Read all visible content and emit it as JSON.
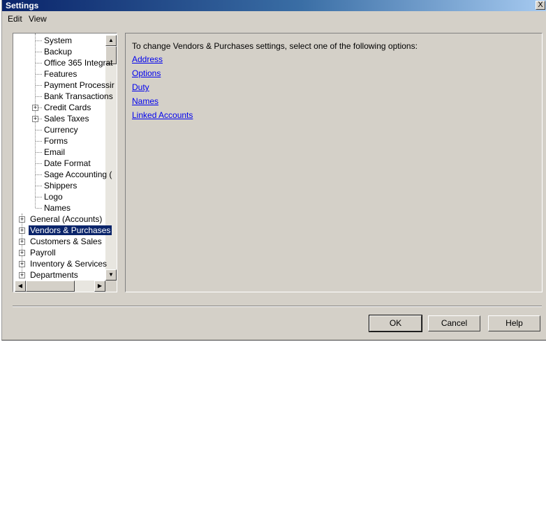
{
  "window": {
    "title": "Settings",
    "close_glyph": "X"
  },
  "menu": [
    "Edit",
    "View"
  ],
  "tree": {
    "children": [
      {
        "label": "System",
        "expandable": false
      },
      {
        "label": "Backup",
        "expandable": false
      },
      {
        "label": "Office 365 Integrat",
        "expandable": false
      },
      {
        "label": "Features",
        "expandable": false
      },
      {
        "label": "Payment Processir",
        "expandable": false
      },
      {
        "label": "Bank Transactions",
        "expandable": false
      },
      {
        "label": "Credit Cards",
        "expandable": true
      },
      {
        "label": "Sales Taxes",
        "expandable": true
      },
      {
        "label": "Currency",
        "expandable": false
      },
      {
        "label": "Forms",
        "expandable": false
      },
      {
        "label": "Email",
        "expandable": false
      },
      {
        "label": "Date Format",
        "expandable": false
      },
      {
        "label": "Sage Accounting (",
        "expandable": false
      },
      {
        "label": "Shippers",
        "expandable": false
      },
      {
        "label": "Logo",
        "expandable": false
      },
      {
        "label": "Names",
        "expandable": false
      }
    ],
    "top_level": [
      {
        "label": "General (Accounts)",
        "selected": false
      },
      {
        "label": "Vendors & Purchases",
        "selected": true
      },
      {
        "label": "Customers & Sales",
        "selected": false
      },
      {
        "label": "Payroll",
        "selected": false
      },
      {
        "label": "Inventory & Services",
        "selected": false
      },
      {
        "label": "Departments",
        "selected": false
      }
    ],
    "expander_glyph": "+"
  },
  "panel": {
    "instruction": "To change Vendors & Purchases settings, select one of the following options:",
    "links": [
      "Address",
      "Options",
      "Duty",
      "Names",
      "Linked Accounts"
    ]
  },
  "buttons": {
    "ok": "OK",
    "cancel": "Cancel",
    "help": "Help"
  },
  "scroll_glyphs": {
    "up": "▲",
    "down": "▼",
    "left": "◀",
    "right": "▶"
  },
  "colors": {
    "selection": "#0a246a",
    "link": "#0000ee",
    "face": "#d4d0c8"
  }
}
